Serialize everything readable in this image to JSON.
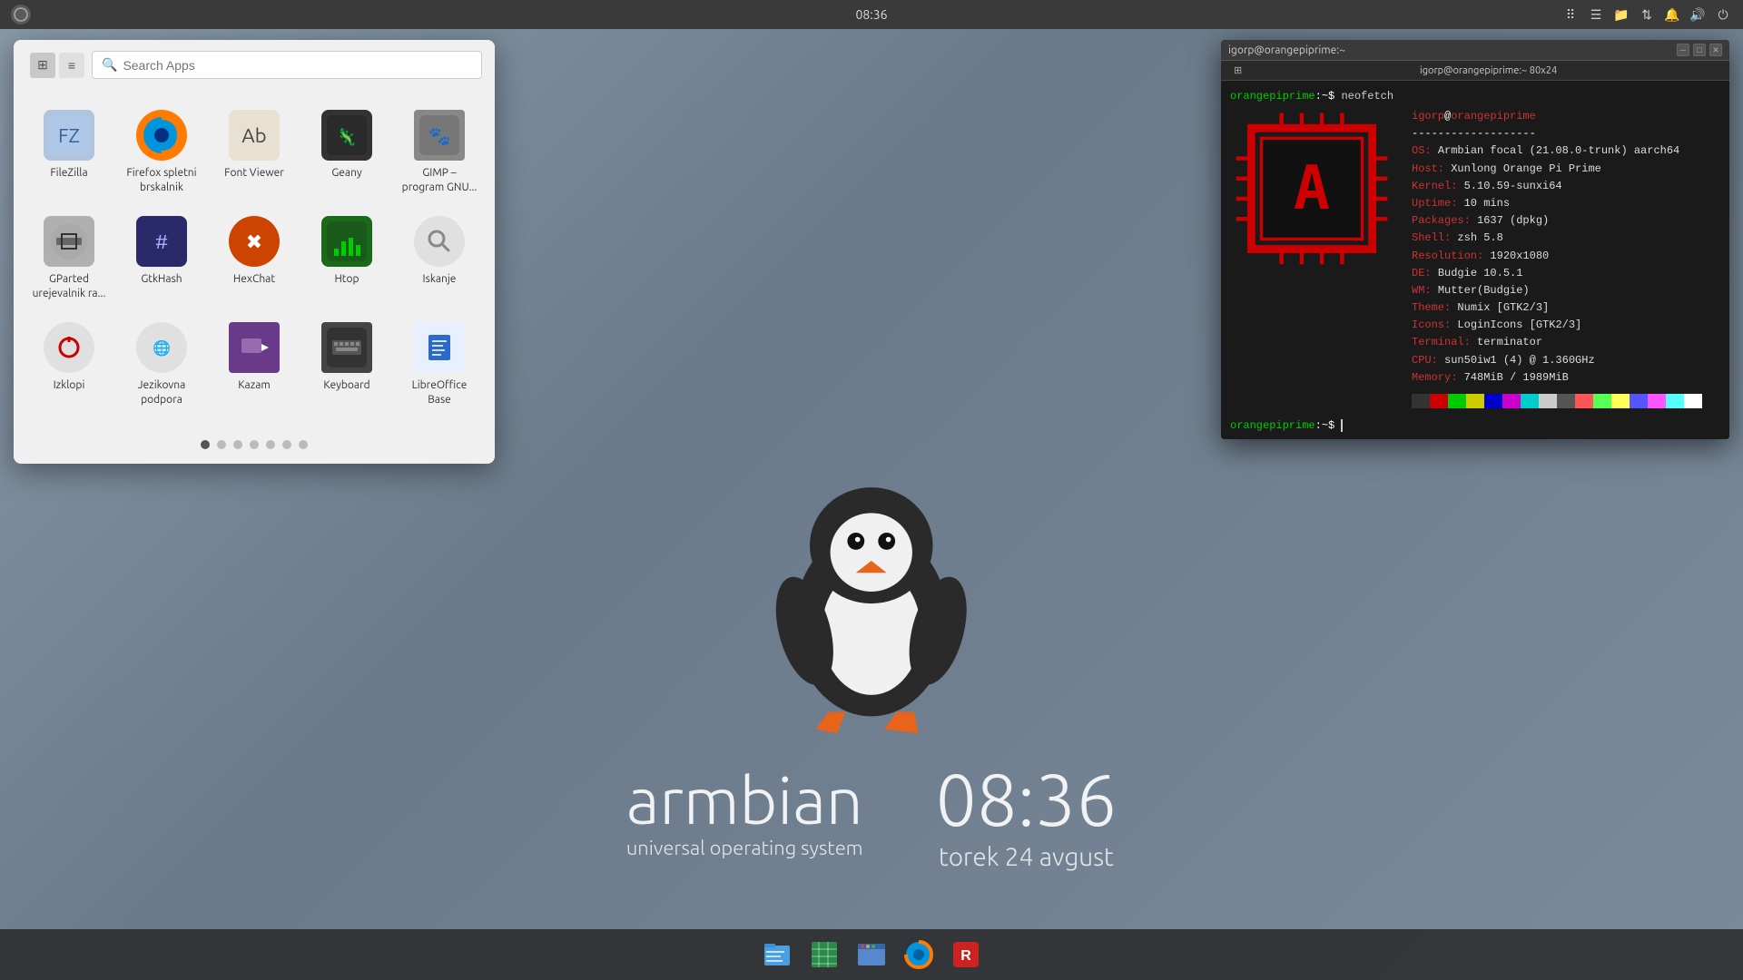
{
  "desktop": {
    "time": "08:36",
    "date": "torek 24 avgust"
  },
  "top_panel": {
    "time": "08:36",
    "icons": [
      "raven",
      "dots",
      "menu",
      "files",
      "network",
      "bell",
      "volume",
      "power"
    ]
  },
  "app_launcher": {
    "search_placeholder": "Search Apps",
    "apps": [
      {
        "id": "filezilla",
        "label": "FileZilla",
        "icon_class": "icon-filezilla",
        "icon_char": "📁"
      },
      {
        "id": "firefox",
        "label": "Firefox spletni brskalnik",
        "icon_class": "icon-firefox",
        "icon_char": "🦊"
      },
      {
        "id": "fontviewer",
        "label": "Font Viewer",
        "icon_class": "icon-fontviewer",
        "icon_char": "Aa"
      },
      {
        "id": "geany",
        "label": "Geany",
        "icon_class": "icon-geany",
        "icon_char": "🦎"
      },
      {
        "id": "gimp",
        "label": "GIMP – program GNU...",
        "icon_class": "icon-gimp",
        "icon_char": "🐾"
      },
      {
        "id": "gparted",
        "label": "GParted urejevalnik ra...",
        "icon_class": "icon-gparted",
        "icon_char": "💿"
      },
      {
        "id": "gtkhash",
        "label": "GtkHash",
        "icon_class": "icon-gtkhash",
        "icon_char": "#"
      },
      {
        "id": "hexchat",
        "label": "HexChat",
        "icon_class": "icon-hexchat",
        "icon_char": "✖"
      },
      {
        "id": "htop",
        "label": "Htop",
        "icon_class": "icon-htop",
        "icon_char": "📊"
      },
      {
        "id": "iskanje",
        "label": "Iskanje",
        "icon_class": "icon-iskanje",
        "icon_char": "🔍"
      },
      {
        "id": "izklopi",
        "label": "Izklopi",
        "icon_class": "icon-izklopi",
        "icon_char": "⏻"
      },
      {
        "id": "jezikovna",
        "label": "Jezikovna podpora",
        "icon_class": "icon-jezikovna",
        "icon_char": "🌐"
      },
      {
        "id": "kazam",
        "label": "Kazam",
        "icon_class": "icon-kazam",
        "icon_char": "📷"
      },
      {
        "id": "keyboard",
        "label": "Keyboard",
        "icon_class": "icon-keyboard",
        "icon_char": "⌨"
      },
      {
        "id": "libreoffice",
        "label": "LibreOffice Base",
        "icon_class": "icon-libreoffice",
        "icon_char": "🗄"
      }
    ],
    "dots": [
      1,
      2,
      3,
      4,
      5,
      6,
      7
    ],
    "active_dot": 1
  },
  "terminal": {
    "title": "igorp@orangepiprime:~",
    "inner_title": "igorp@orangepiprime:~ 80x24",
    "command": "neofetch",
    "user": "igorp",
    "host": "orangepiprime",
    "info": {
      "OS": "Armbian focal (21.08.0-trunk) aarch64",
      "Host": "Xunlong Orange Pi Prime",
      "Kernel": "5.10.59-sunxi64",
      "Uptime": "10 mins",
      "Packages": "1637 (dpkg)",
      "Shell": "zsh 5.8",
      "Resolution": "1920x1080",
      "DE": "Budgie 10.5.1",
      "WM": "Mutter(Budgie)",
      "Theme": "Numix [GTK2/3]",
      "Icons": "LoginIcons [GTK2/3]",
      "Terminal": "terminator",
      "CPU": "sun50iw1 (4) @ 1.360GHz",
      "Memory": "748MiB / 1989MiB"
    },
    "prompt": "orangepiprime:~$ "
  },
  "armbian": {
    "name": "armbian",
    "subtitle": "universal operating system",
    "clock_time": "08:36",
    "clock_date": "torek 24 avgust"
  },
  "taskbar": {
    "items": [
      {
        "id": "files",
        "icon": "📄"
      },
      {
        "id": "spreadsheet",
        "icon": "📊"
      },
      {
        "id": "browser2",
        "icon": "🖥"
      },
      {
        "id": "firefox-tb",
        "icon": "🦊"
      },
      {
        "id": "redapp",
        "icon": "🔴"
      }
    ]
  }
}
